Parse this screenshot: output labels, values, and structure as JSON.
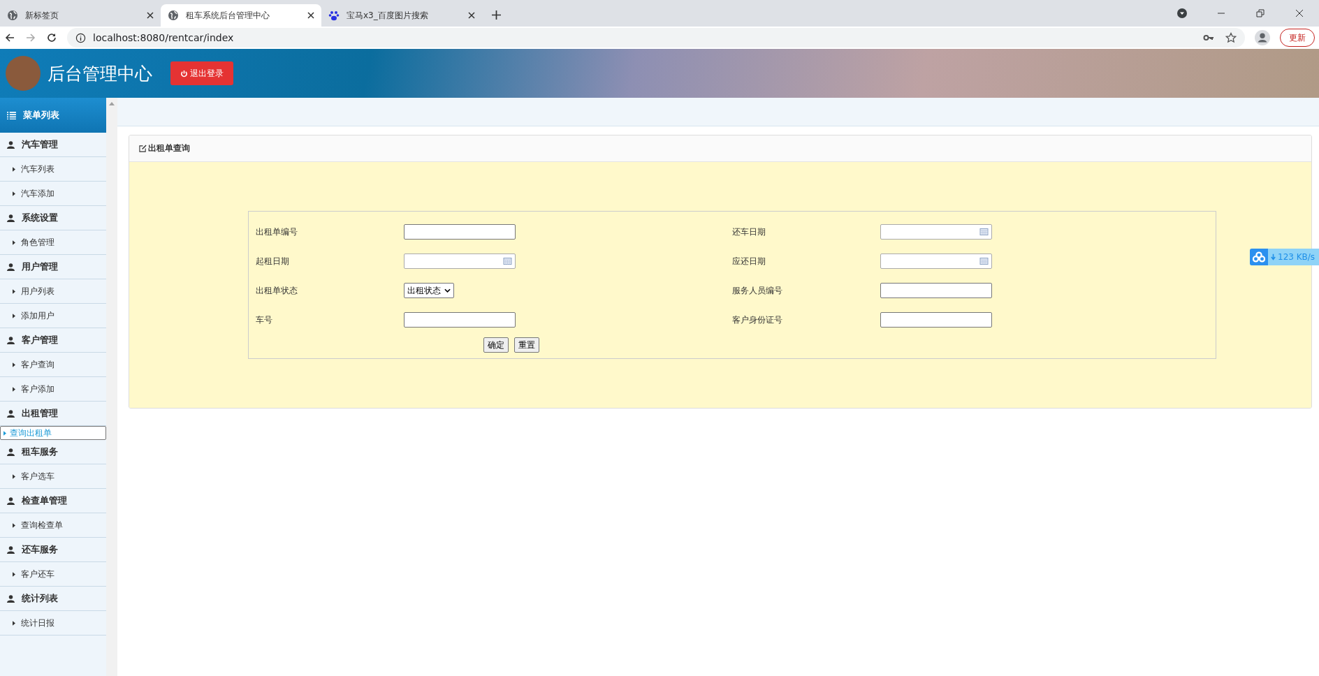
{
  "browser": {
    "tabs": [
      {
        "title": "新标签页",
        "kind": "globe",
        "selected": false
      },
      {
        "title": "租车系统后台管理中心",
        "kind": "globe",
        "selected": true
      },
      {
        "title": "宝马x3_百度图片搜索",
        "kind": "paw",
        "selected": false
      }
    ],
    "address": "localhost:8080/rentcar/index",
    "update_button": "更新"
  },
  "header": {
    "title": "后台管理中心",
    "logout_button": "退出登录"
  },
  "sidebar": {
    "title": "菜单列表",
    "groups": [
      {
        "label": "汽车管理",
        "children": [
          {
            "label": "汽车列表",
            "selected": false
          },
          {
            "label": "汽车添加",
            "selected": false
          }
        ]
      },
      {
        "label": "系统设置",
        "children": [
          {
            "label": "角色管理",
            "selected": false
          }
        ]
      },
      {
        "label": "用户管理",
        "children": [
          {
            "label": "用户列表",
            "selected": false
          },
          {
            "label": "添加用户",
            "selected": false
          }
        ]
      },
      {
        "label": "客户管理",
        "children": [
          {
            "label": "客户查询",
            "selected": false
          },
          {
            "label": "客户添加",
            "selected": false
          }
        ]
      },
      {
        "label": "出租管理",
        "children": [
          {
            "label": "查询出租单",
            "selected": true
          }
        ]
      },
      {
        "label": "租车服务",
        "children": [
          {
            "label": "客户选车",
            "selected": false
          }
        ]
      },
      {
        "label": "检查单管理",
        "children": [
          {
            "label": "查询检查单",
            "selected": false
          }
        ]
      },
      {
        "label": "还车服务",
        "children": [
          {
            "label": "客户还车",
            "selected": false
          }
        ]
      },
      {
        "label": "统计列表",
        "children": [
          {
            "label": "统计日报",
            "selected": false
          }
        ]
      }
    ]
  },
  "panel": {
    "title": "出租单查询",
    "fields": [
      {
        "label": "出租单编号",
        "kind": "text"
      },
      {
        "label": "还车日期",
        "kind": "date"
      },
      {
        "label": "起租日期",
        "kind": "date"
      },
      {
        "label": "应还日期",
        "kind": "date"
      },
      {
        "label": "出租单状态",
        "kind": "select",
        "value": "出租状态"
      },
      {
        "label": "服务人员编号",
        "kind": "text"
      },
      {
        "label": "车号",
        "kind": "text"
      },
      {
        "label": "客户身份证号",
        "kind": "text"
      }
    ],
    "buttons": [
      "确定",
      "重置"
    ]
  },
  "download_widget": {
    "speed": "123 KB/s"
  }
}
